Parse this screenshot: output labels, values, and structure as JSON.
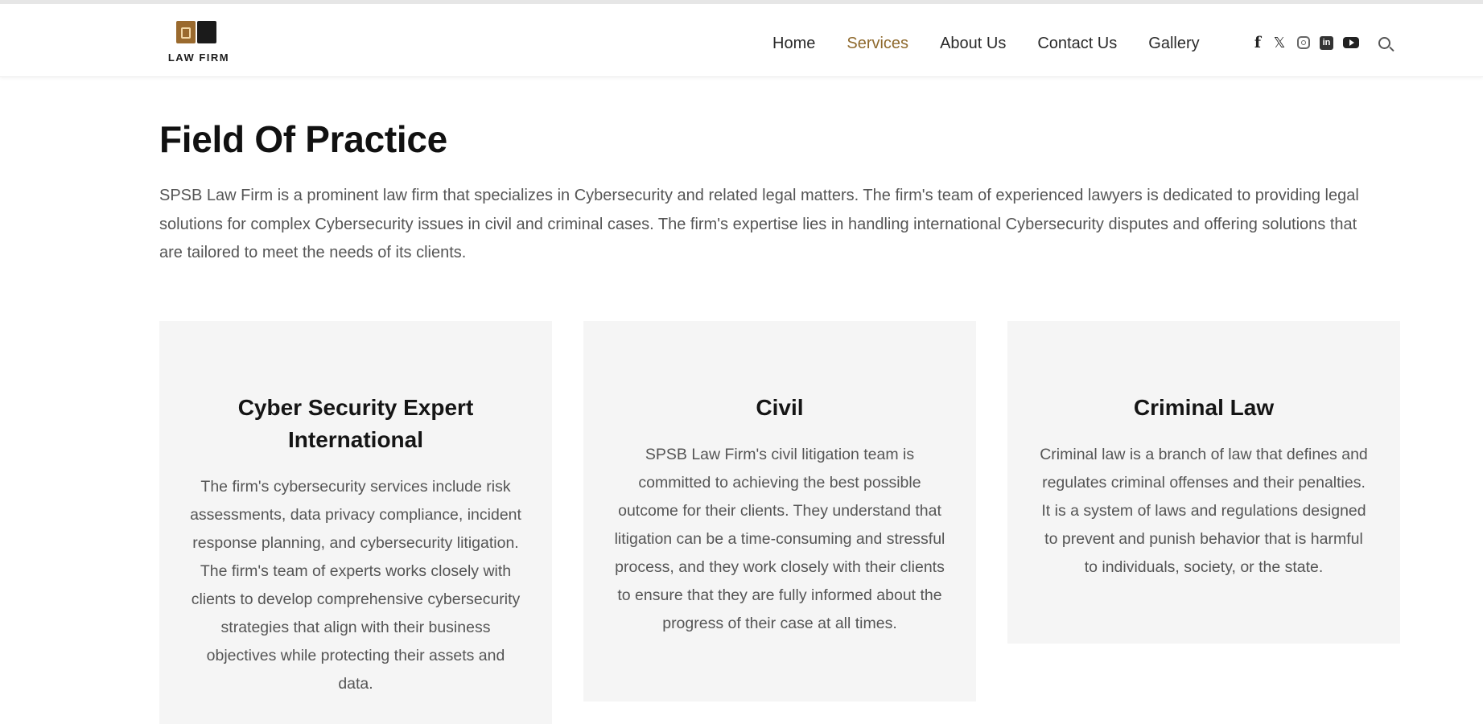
{
  "header": {
    "logo_text": "LAW FIRM",
    "nav": [
      {
        "label": "Home"
      },
      {
        "label": "Services"
      },
      {
        "label": "About Us"
      },
      {
        "label": "Contact Us"
      },
      {
        "label": "Gallery"
      }
    ],
    "active_nav": "Services",
    "social_icons": [
      "facebook-icon",
      "twitter-icon",
      "instagram-icon",
      "linkedin-icon",
      "youtube-icon",
      "search-icon"
    ],
    "accent_color": "#8f6a2e"
  },
  "main": {
    "title": "Field Of Practice",
    "intro": "SPSB Law Firm is a prominent law firm that specializes in Cybersecurity and related legal matters. The firm's team of experienced lawyers is dedicated to providing legal solutions for complex Cybersecurity issues in civil and criminal cases. The firm's expertise lies in handling international Cybersecurity disputes and offering solutions that are tailored to meet the needs of its clients.",
    "cards": [
      {
        "title": "Cyber Security Expert International",
        "text": "The firm's cybersecurity services include risk assessments, data privacy compliance, incident response planning, and cybersecurity litigation. The firm's team of experts works closely with clients to develop comprehensive cybersecurity strategies that align with their business objectives while protecting their assets and data."
      },
      {
        "title": "Civil",
        "text": "SPSB Law Firm's civil litigation team is committed to achieving the best possible outcome for their clients. They understand that litigation can be a time-consuming and stressful process, and they work closely with their clients to ensure that they are fully informed about the progress of their case at all times."
      },
      {
        "title": "Criminal Law",
        "text": "Criminal law is a branch of law that defines and regulates criminal offenses and their penalties. It is a system of laws and regulations designed to prevent and punish behavior that is harmful to individuals, society, or the state."
      }
    ]
  }
}
